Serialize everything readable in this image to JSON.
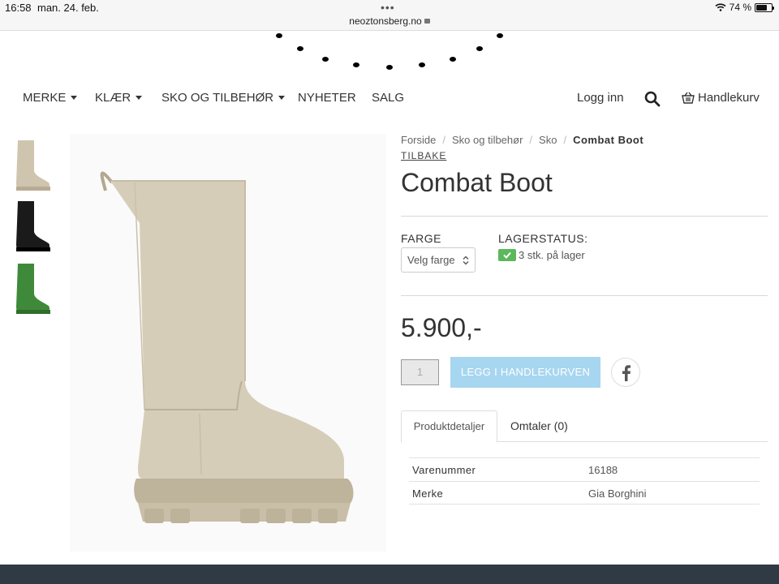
{
  "status_bar": {
    "time": "16:58",
    "date": "man. 24. feb.",
    "url": "neoztonsberg.no",
    "battery": "74 %"
  },
  "nav": {
    "items": [
      {
        "label": "MERKE",
        "dropdown": true
      },
      {
        "label": "KLÆR",
        "dropdown": true
      },
      {
        "label": "SKO OG TILBEHØR",
        "dropdown": true
      },
      {
        "label": "NYHETER",
        "dropdown": false
      },
      {
        "label": "SALG",
        "dropdown": false
      }
    ],
    "login": "Logg inn",
    "cart": "Handlekurv"
  },
  "breadcrumb": {
    "items": [
      "Forside",
      "Sko og tilbehør",
      "Sko"
    ],
    "current": "Combat Boot"
  },
  "back_link": "TILBAKE",
  "product": {
    "title": "Combat Boot",
    "color_label": "FARGE",
    "color_select": "Velg farge",
    "stock_label": "LAGERSTATUS:",
    "stock_text": "3 stk. på lager",
    "price": "5.900,-",
    "quantity": "1",
    "add_to_cart": "LEGG I HANDLEKURVEN"
  },
  "thumbnails": [
    {
      "color_name": "beige",
      "color": "#cfc4ae"
    },
    {
      "color_name": "black",
      "color": "#1a1a1a"
    },
    {
      "color_name": "green",
      "color": "#3f8a3a"
    }
  ],
  "tabs": [
    {
      "label": "Produktdetaljer",
      "active": true
    },
    {
      "label": "Omtaler (0)",
      "active": false
    }
  ],
  "details": {
    "rows": [
      {
        "key": "Varenummer",
        "value": "16188"
      },
      {
        "key": "Merke",
        "value": "Gia Borghini"
      }
    ]
  },
  "colors": {
    "accent_button": "#a7d6f0",
    "stock_check": "#5cb85c",
    "footer": "#2f3a44"
  }
}
